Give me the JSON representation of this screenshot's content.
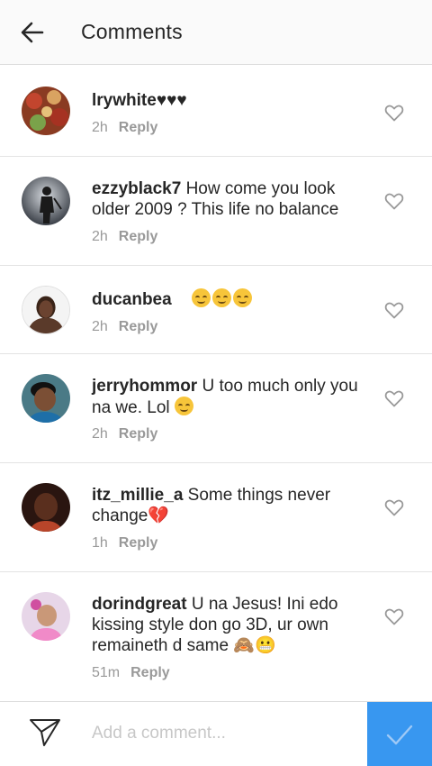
{
  "header": {
    "title": "Comments"
  },
  "comments": [
    {
      "username": "lrywhite",
      "text": "♥♥♥",
      "time": "2h",
      "reply": "Reply"
    },
    {
      "username": "ezzyblack7",
      "text": " How come you look older 2009 ? This life no balance",
      "time": "2h",
      "reply": "Reply"
    },
    {
      "username": "ducanbea",
      "text": "",
      "time": "2h",
      "reply": "Reply",
      "emoji_count": 3
    },
    {
      "username": "jerryhommor",
      "text": " U too much only you na we. Lol",
      "time": "2h",
      "reply": "Reply",
      "emoji_count": 1
    },
    {
      "username": "itz_millie_a",
      "text": " Some things never change💔",
      "time": "1h",
      "reply": "Reply"
    },
    {
      "username": "dorindgreat",
      "text": " U na Jesus! Ini edo kissing style don go 3D, ur own remaineth  d same 🙈😬",
      "time": "51m",
      "reply": "Reply"
    }
  ],
  "footer": {
    "placeholder": "Add a comment..."
  },
  "colors": {
    "accent": "#3897f0",
    "header_bg": "#fafafa",
    "muted": "#999999"
  },
  "icons": [
    "back-arrow-icon",
    "heart-icon",
    "send-icon",
    "check-icon"
  ]
}
